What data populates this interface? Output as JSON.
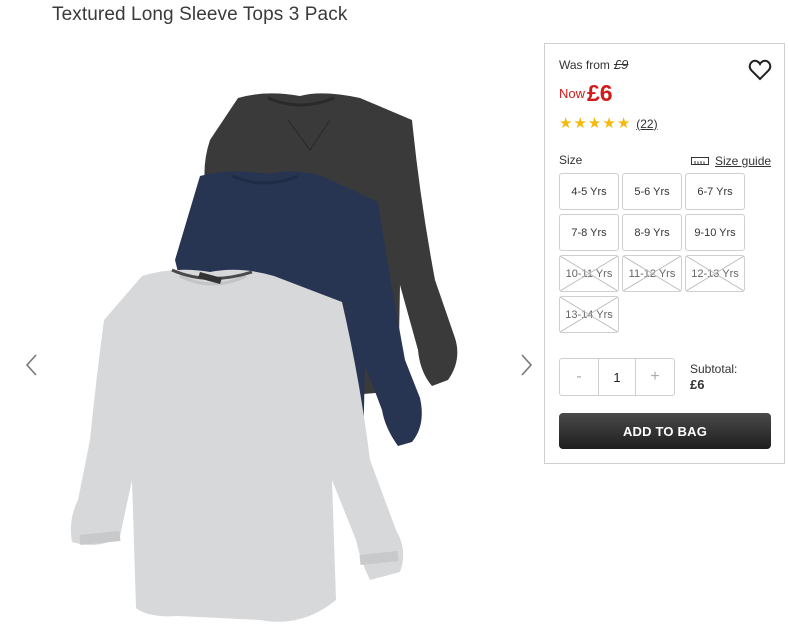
{
  "product": {
    "title": "Textured Long Sleeve Tops 3 Pack"
  },
  "price": {
    "was_label": "Was from",
    "was_value": "£9",
    "now_label": "Now",
    "now_value": "£6"
  },
  "rating": {
    "stars": 5,
    "reviews": "(22)"
  },
  "sizes": {
    "label": "Size",
    "guide_label": "Size guide",
    "options": [
      {
        "label": "4-5 Yrs",
        "available": true
      },
      {
        "label": "5-6 Yrs",
        "available": true
      },
      {
        "label": "6-7 Yrs",
        "available": true
      },
      {
        "label": "7-8 Yrs",
        "available": true
      },
      {
        "label": "8-9 Yrs",
        "available": true
      },
      {
        "label": "9-10 Yrs",
        "available": true
      },
      {
        "label": "10-11 Yrs",
        "available": false
      },
      {
        "label": "11-12 Yrs",
        "available": false
      },
      {
        "label": "12-13 Yrs",
        "available": false
      },
      {
        "label": "13-14 Yrs",
        "available": false
      }
    ]
  },
  "quantity": {
    "minus": "-",
    "value": "1",
    "plus": "+"
  },
  "subtotal": {
    "label": "Subtotal:",
    "value": "£6"
  },
  "actions": {
    "add_to_bag": "ADD TO BAG"
  },
  "colors": {
    "price_red": "#d11a1a",
    "star_gold": "#f5b90c",
    "button_dark": "#1e1e1e"
  },
  "icons": [
    "chevron-left-icon",
    "chevron-right-icon",
    "heart-icon",
    "ruler-icon",
    "star-icon"
  ]
}
